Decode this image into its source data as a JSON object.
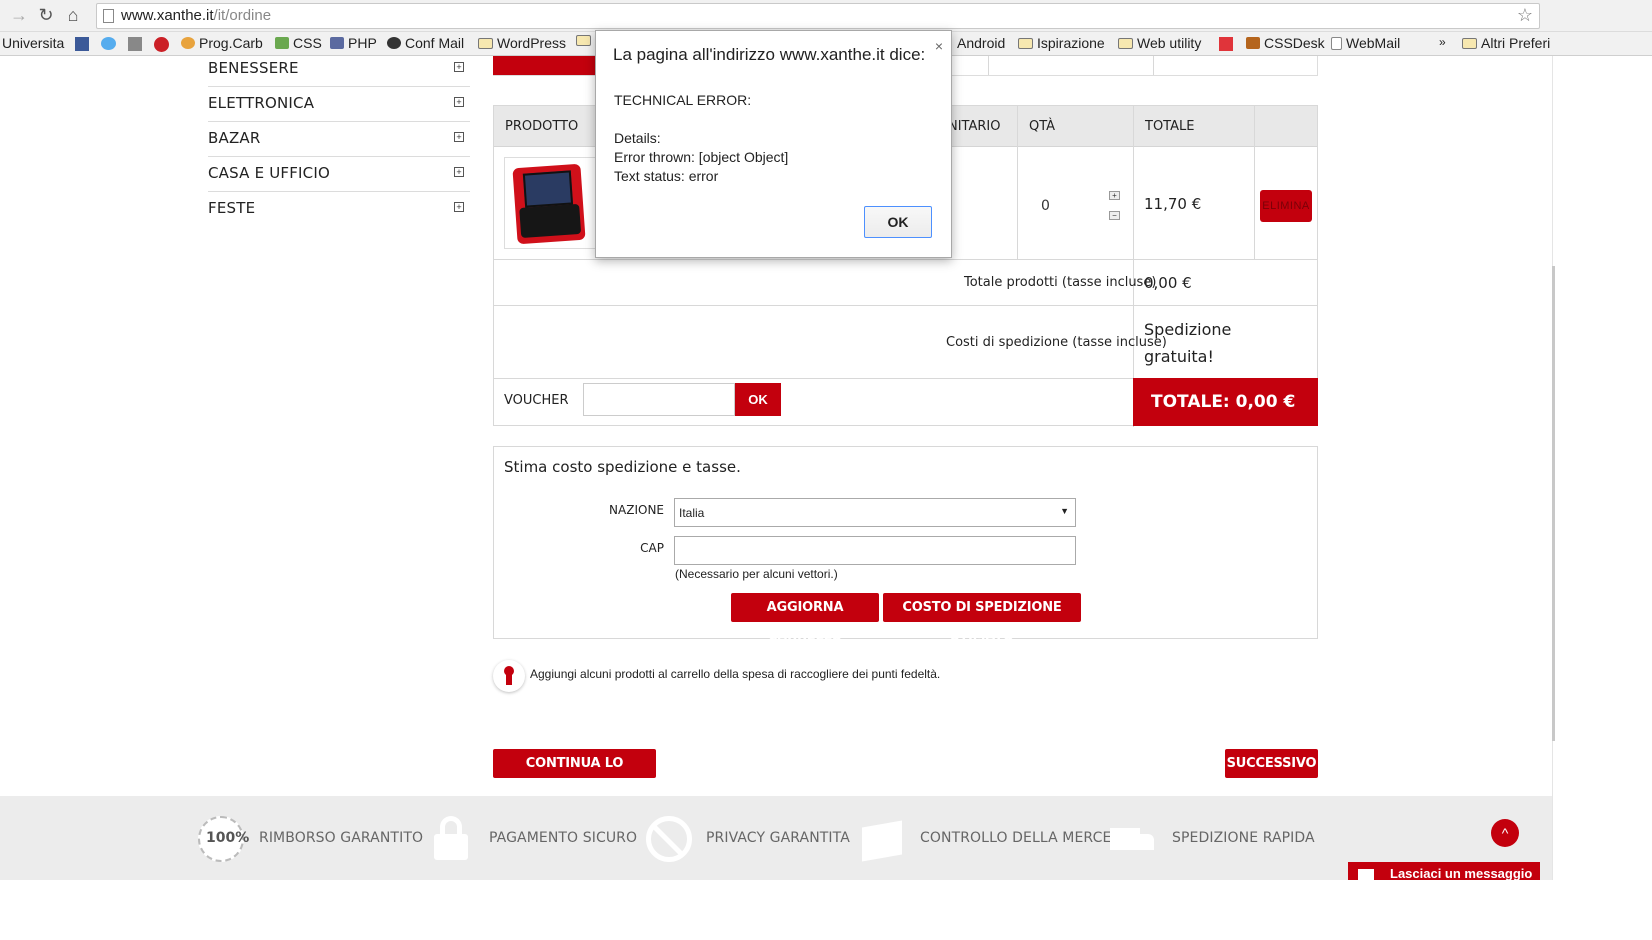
{
  "browser": {
    "url_host": "www.xanthe.it",
    "url_path": "/it/ordine",
    "bookmarks": [
      "Universita",
      "Prog.Carb",
      "CSS",
      "PHP",
      "Conf Mail",
      "WordPress",
      "Android",
      "Ispirazione",
      "Web utility",
      "CSSDesk",
      "WebMail",
      "»",
      "Altri Preferi"
    ]
  },
  "categories": [
    "BENESSERE",
    "ELETTRONICA",
    "BAZAR",
    "CASA E UFFICIO",
    "FESTE"
  ],
  "cart": {
    "headers": {
      "product": "PRODOTTO",
      "unit": "NITARIO",
      "qty": "QTÀ",
      "total": "TOTALE"
    },
    "item": {
      "qty": "0",
      "total": "11,70 €",
      "delete_label": "ELIMINA"
    },
    "products_total_label": "Totale prodotti (tasse incluse)",
    "products_total_value": "0,00 €",
    "shipping_label": "Costi di spedizione (tasse incluse)",
    "shipping_value_line1": "Spedizione",
    "shipping_value_line2": "gratuita!",
    "voucher_label": "VOUCHER",
    "voucher_ok": "OK",
    "grand_total": "TOTALE:  0,00 €"
  },
  "estimate": {
    "title": "Stima costo spedizione e tasse.",
    "country_label": "NAZIONE",
    "country_value": "Italia",
    "zip_label": "CAP",
    "zip_hint": "(Necessario per alcuni vettori.)",
    "update_button": "AGGIORNA CARRELLO",
    "estimate_button": "COSTO DI SPEDIZIONE STIMATO"
  },
  "loyalty_text": "Aggiungi alcuni prodotti al carrello della spesa di raccogliere dei punti fedeltà.",
  "nav_buttons": {
    "continue": "CONTINUA LO SHOPPING",
    "next": "SUCCESSIVO"
  },
  "footer": {
    "badge_100": "100%",
    "features": [
      "RIMBORSO GARANTITO",
      "PAGAMENTO SICURO",
      "PRIVACY GARANTITA",
      "CONTROLLO DELLA MERCE",
      "SPEDIZIONE RAPIDA"
    ],
    "chat_label": "Lasciaci un messaggio"
  },
  "dialog": {
    "title": "La pagina all'indirizzo www.xanthe.it dice:",
    "line1": "TECHNICAL ERROR:",
    "line2": "Details:",
    "line3": "Error thrown: [object Object]",
    "line4": "Text status: error",
    "ok": "OK"
  },
  "colors": {
    "brand_red": "#c3000d"
  }
}
